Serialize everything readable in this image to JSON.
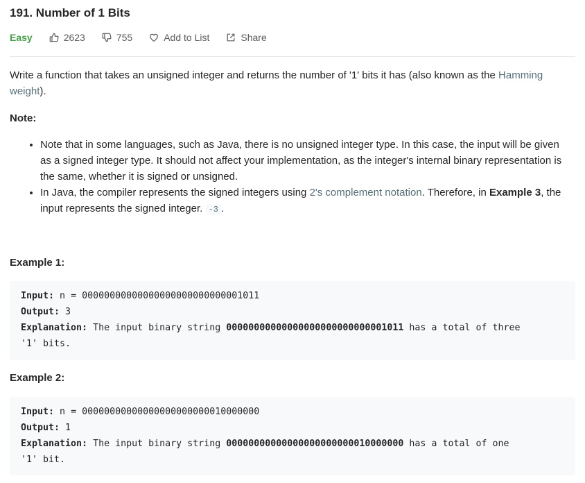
{
  "problem": {
    "title": "191. Number of 1 Bits",
    "difficulty": "Easy",
    "likes": "2623",
    "dislikes": "755",
    "add_to_list": "Add to List",
    "share": "Share"
  },
  "colors": {
    "easy": "#43a047",
    "link": "#546e7a",
    "code_bg": "#f7f9fa"
  },
  "description": {
    "text_before": "Write a function that takes an unsigned integer and returns the number of '1' bits it has (also known as the ",
    "link": "Hamming weight",
    "text_after": ")."
  },
  "note": {
    "label": "Note:",
    "item1": "Note that in some languages, such as Java, there is no unsigned integer type. In this case, the input will be given as a signed integer type. It should not affect your implementation, as the integer's internal binary representation is the same, whether it is signed or unsigned.",
    "item2_a": "In Java, the compiler represents the signed integers using ",
    "item2_link": "2's complement notation",
    "item2_b": ". Therefore, in ",
    "item2_bold": "Example 3",
    "item2_c": ", the input represents the signed integer. ",
    "item2_code": "-3",
    "item2_d": "."
  },
  "examples": [
    {
      "label": "Example 1:",
      "input_label": "Input:",
      "input_value": " n = 00000000000000000000000000001011",
      "output_label": "Output:",
      "output_value": " 3",
      "explanation_label": "Explanation:",
      "explanation_a": " The input binary string ",
      "explanation_bold": "00000000000000000000000000001011",
      "explanation_b": " has a total of three ",
      "explanation_c": "'1' bits."
    },
    {
      "label": "Example 2:",
      "input_label": "Input:",
      "input_value": " n = 00000000000000000000000010000000",
      "output_label": "Output:",
      "output_value": " 1",
      "explanation_label": "Explanation:",
      "explanation_a": " The input binary string ",
      "explanation_bold": "00000000000000000000000010000000",
      "explanation_b": " has a total of one ",
      "explanation_c": "'1' bit."
    }
  ]
}
